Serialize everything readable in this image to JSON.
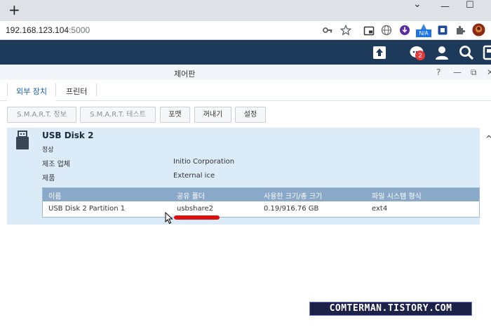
{
  "browser": {
    "new_tab_symbol": "+",
    "minimize_symbol": "—",
    "maximize_symbol": "☐",
    "chevron_symbol": "⌄",
    "url_host": "192.168.123.104",
    "url_port": ":5000",
    "ext_badge_label": "N/A"
  },
  "dsm": {
    "notification_count": "2"
  },
  "window": {
    "title": "제어판",
    "help": "?",
    "minimize": "—",
    "restore": "⧉",
    "close": "✕"
  },
  "tabs": [
    {
      "label": "외부 장치",
      "active": true
    },
    {
      "label": "프린터",
      "active": false
    }
  ],
  "toolbar": {
    "smart_info": "S.M.A.R.T. 정보",
    "smart_test": "S.M.A.R.T. 테스트",
    "format": "포맷",
    "eject": "꺼내기",
    "settings": "설정"
  },
  "device": {
    "name": "USB Disk 2",
    "status": "정상",
    "vendor_label": "제조 업체",
    "vendor_value": "Initio Corporation",
    "product_label": "제품",
    "product_value": "External ice",
    "collapse_symbol": "^"
  },
  "partition_table": {
    "columns": [
      "이름",
      "공유 폴더",
      "사용한 크기/총 크기",
      "파일 시스템 형식"
    ],
    "rows": [
      [
        "USB Disk 2 Partition 1",
        "usbshare2",
        "0.19/916.76 GB",
        "ext4"
      ]
    ]
  },
  "watermark": "COMTERMAN.TISTORY.COM",
  "colors": {
    "dsm_bar": "#1e3a5a",
    "panel_bg": "#dcebf8",
    "table_header": "#8aa9c8",
    "highlight": "#e01010"
  }
}
